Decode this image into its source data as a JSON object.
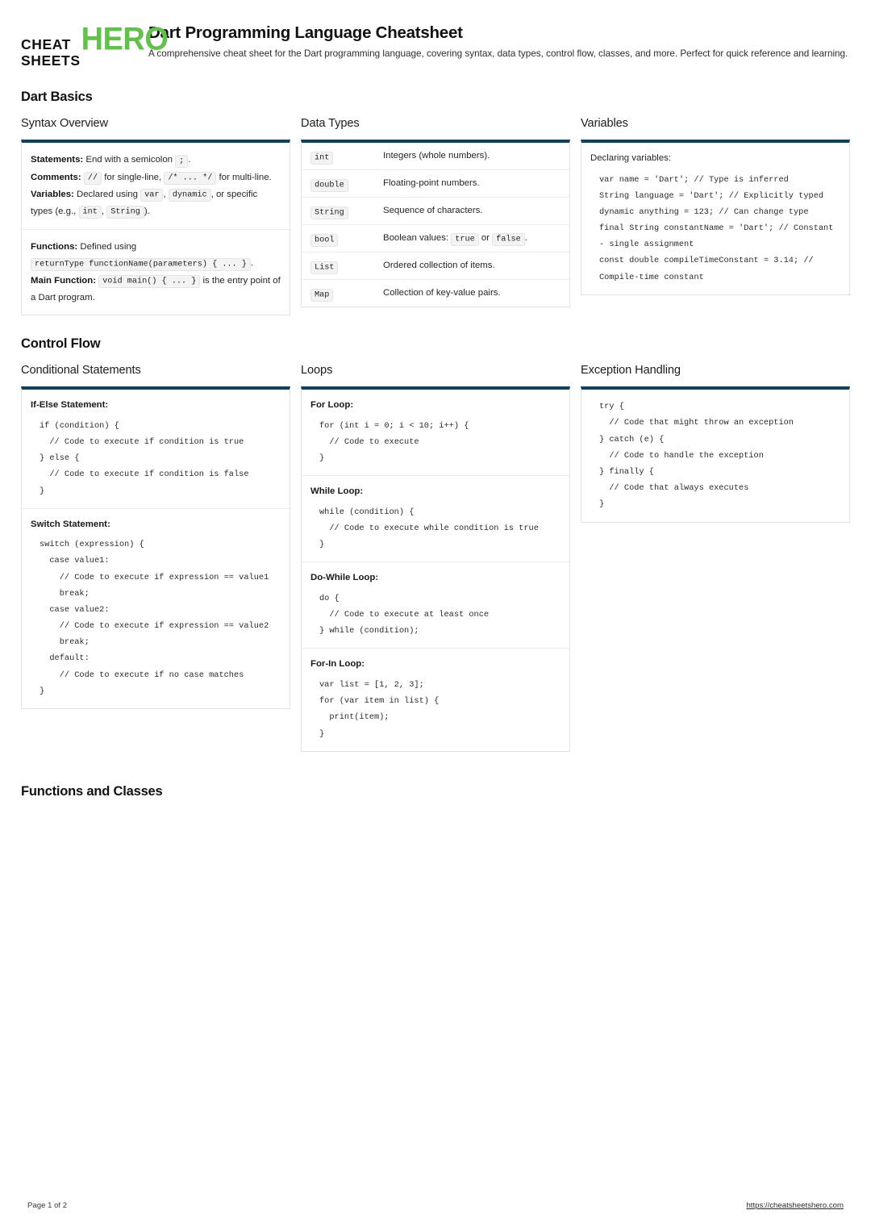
{
  "brand": {
    "line1": "CHEAT",
    "line2": "SHEETS",
    "hero": "HERO",
    "hero_color": "#62c14a"
  },
  "header": {
    "title": "Dart Programming Language Cheatsheet",
    "subtitle": "A comprehensive cheat sheet for the Dart programming language, covering syntax, data types, control flow, classes, and more. Perfect for quick reference and learning."
  },
  "theme": {
    "card_top_border": "#10405f",
    "card_border": "#e2e2e2",
    "chip_bg": "#f3f3f3"
  },
  "sections": [
    {
      "title": "Dart Basics"
    },
    {
      "title": "Control Flow"
    },
    {
      "title": "Functions and Classes"
    }
  ],
  "cards": {
    "syntax_overview": {
      "title": "Syntax Overview",
      "blocks": [
        {
          "statements_label": "Statements:",
          "statements_text_1": " End with a semicolon ",
          "statements_code": ";",
          "statements_text_2": ".",
          "comments_label": "Comments:",
          "comments_code_1": "//",
          "comments_text_1": " for single-line, ",
          "comments_code_2": "/* ... */",
          "comments_text_2": " for multi-line.",
          "variables_label": "Variables:",
          "variables_text_1": " Declared using ",
          "variables_code_1": "var",
          "variables_text_2": ", ",
          "variables_code_2": "dynamic",
          "variables_text_3": ", or specific types (e.g., ",
          "variables_code_3": "int",
          "variables_text_4": ", ",
          "variables_code_4": "String",
          "variables_text_5": ")."
        },
        {
          "functions_label": "Functions:",
          "functions_text_1": " Defined using ",
          "functions_code_1": "returnType functionName(parameters) { ... }",
          "functions_text_2": ".",
          "main_label": "Main Function:",
          "main_code": "void main() { ... }",
          "main_text": " is the entry point of a Dart program."
        }
      ]
    },
    "data_types": {
      "title": "Data Types",
      "rows": [
        {
          "type": "int",
          "desc": "Integers (whole numbers)."
        },
        {
          "type": "double",
          "desc": "Floating-point numbers."
        },
        {
          "type": "String",
          "desc": "Sequence of characters."
        },
        {
          "type": "bool",
          "desc_pre": "Boolean values: ",
          "code_a": "true",
          "desc_mid": " or ",
          "code_b": "false",
          "desc_post": "."
        },
        {
          "type": "List",
          "desc": "Ordered collection of items."
        },
        {
          "type": "Map",
          "desc": "Collection of key-value pairs."
        }
      ]
    },
    "variables": {
      "title": "Variables",
      "intro": "Declaring variables:",
      "code": "var name = 'Dart'; // Type is inferred\nString language = 'Dart'; // Explicitly typed\ndynamic anything = 123; // Can change type\nfinal String constantName = 'Dart'; // Constant - single assignment\nconst double compileTimeConstant = 3.14; // Compile-time constant"
    },
    "conditional_statements": {
      "title": "Conditional Statements",
      "if_else_label": "If-Else Statement:",
      "if_else_code": "if (condition) {\n  // Code to execute if condition is true\n} else {\n  // Code to execute if condition is false\n}",
      "switch_label": "Switch Statement:",
      "switch_code": "switch (expression) {\n  case value1:\n    // Code to execute if expression == value1\n    break;\n  case value2:\n    // Code to execute if expression == value2\n    break;\n  default:\n    // Code to execute if no case matches\n}"
    },
    "loops": {
      "title": "Loops",
      "for_label": "For Loop:",
      "for_code": "for (int i = 0; i < 10; i++) {\n  // Code to execute\n}",
      "while_label": "While Loop:",
      "while_code": "while (condition) {\n  // Code to execute while condition is true\n}",
      "dowhile_label": "Do-While Loop:",
      "dowhile_code": "do {\n  // Code to execute at least once\n} while (condition);",
      "forin_label": "For-In Loop:",
      "forin_code": "var list = [1, 2, 3];\nfor (var item in list) {\n  print(item);\n}"
    },
    "exception_handling": {
      "title": "Exception Handling",
      "code": "try {\n  // Code that might throw an exception\n} catch (e) {\n  // Code to handle the exception\n} finally {\n  // Code that always executes\n}"
    }
  },
  "footer": {
    "page_label": "Page 1 of 2",
    "url": "https://cheatsheetshero.com"
  }
}
